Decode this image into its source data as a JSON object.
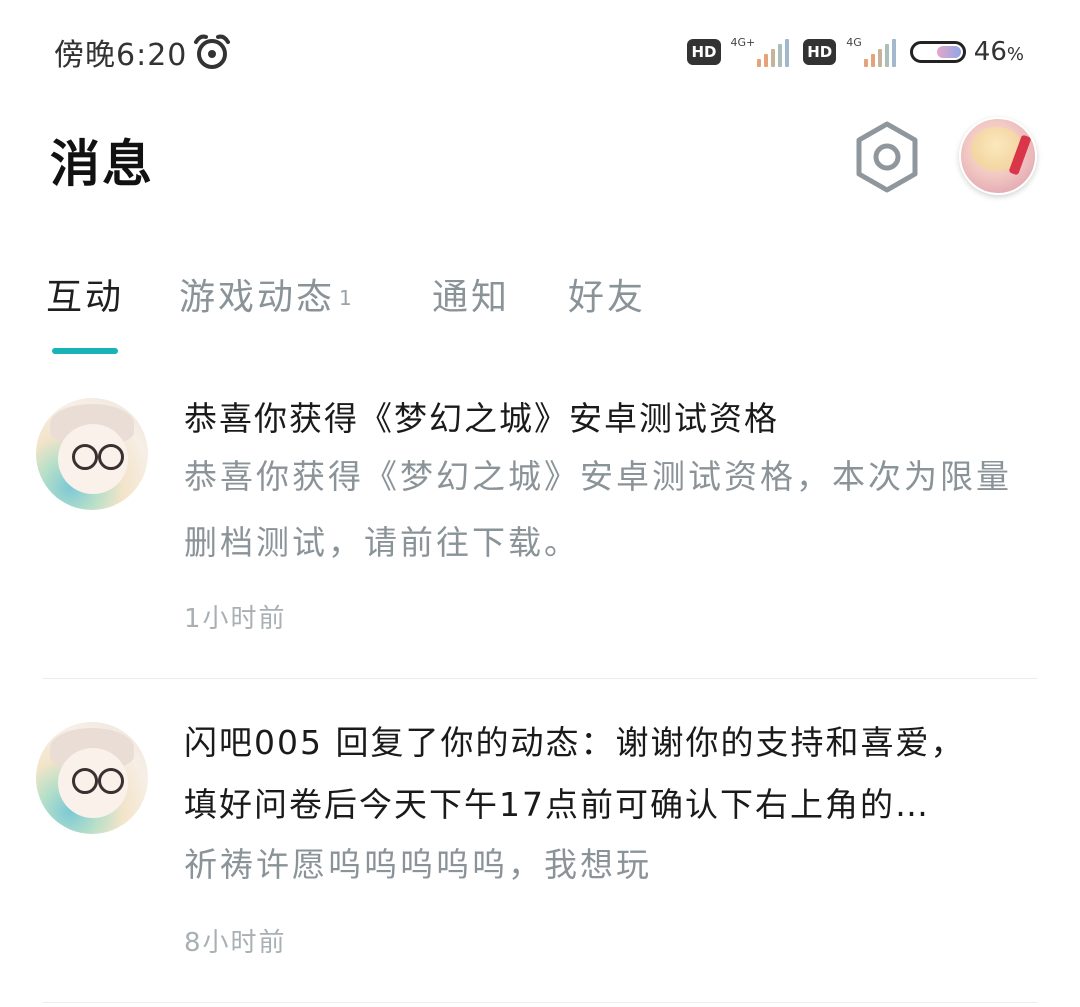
{
  "status_bar": {
    "time": "傍晚6:20",
    "sim1_hd": "HD",
    "sim1_network": "4G+",
    "sim2_hd": "HD",
    "sim2_network": "4G",
    "battery_percent": "46",
    "battery_unit": "%",
    "icons": [
      "alarm-icon",
      "signal-icon",
      "battery-icon"
    ]
  },
  "header": {
    "title": "消息",
    "settings_icon": "hexagon-gear-icon",
    "avatar": "user-avatar"
  },
  "tabs": [
    {
      "label": "互动",
      "active": true,
      "badge": ""
    },
    {
      "label": "游戏动态",
      "active": false,
      "badge": "1"
    },
    {
      "label": "通知",
      "active": false,
      "badge": ""
    },
    {
      "label": "好友",
      "active": false,
      "badge": ""
    }
  ],
  "accent_color": "#17b3b6",
  "messages": [
    {
      "title": "恭喜你获得《梦幻之城》安卓测试资格",
      "body": "恭喜你获得《梦幻之城》安卓测试资格，本次为限量删档测试，请前往下载。",
      "time": "1小时前"
    },
    {
      "title_line1": "闪吧005 回复了你的动态：谢谢你的支持和喜爱，",
      "title_line2": "填好问卷后今天下午17点前可确认下右上角的…",
      "body": "祈祷许愿呜呜呜呜呜，我想玩",
      "time": "8小时前"
    }
  ]
}
